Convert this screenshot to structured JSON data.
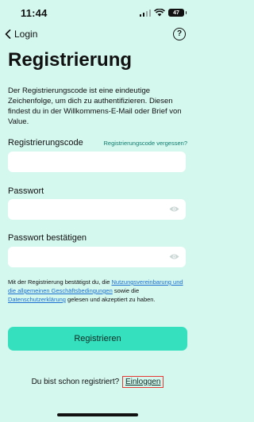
{
  "status_bar": {
    "time": "11:44",
    "battery": "47"
  },
  "nav": {
    "back_label": "Login",
    "help_symbol": "?"
  },
  "page": {
    "title": "Registrierung",
    "intro": "Der Registrierungscode ist eine eindeutige Zeichenfolge, um dich zu authentifizieren. Diesen findest du in der Willkommens-E-Mail oder Brief von Value."
  },
  "form": {
    "code_label": "Registrierungscode",
    "forgot_label": "Registrierungscode vergessen?",
    "password_label": "Passwort",
    "confirm_label": "Passwort bestätigen",
    "code_value": "",
    "password_value": "",
    "confirm_value": ""
  },
  "consent": {
    "prefix": "Mit der Registrierung bestätigst du, die ",
    "terms_link": "Nutzungsvereinbarung und die allgemeinen Geschäftsbedingungen",
    "middle": " sowie die ",
    "privacy_link": "Datenschutzerklärung",
    "suffix": " gelesen und akzeptiert zu haben."
  },
  "actions": {
    "register_label": "Registrieren",
    "login_prompt": "Du bist schon registriert? ",
    "login_link": "Einloggen"
  },
  "colors": {
    "background": "#d4f7ee",
    "primary": "#34e0be",
    "link": "#1c6fd1",
    "highlight_box": "#e53935"
  }
}
